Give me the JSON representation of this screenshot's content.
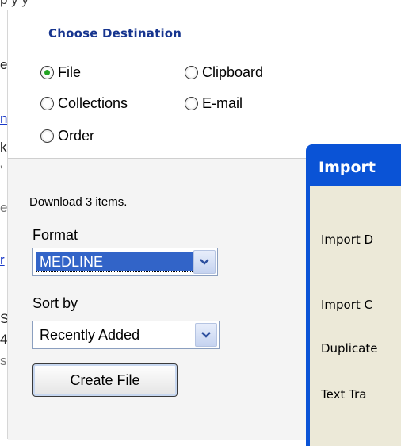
{
  "background": {
    "top_cut": "p        y        y",
    "fragments": [
      {
        "text": "e",
        "kind": "plain"
      },
      {
        "text": "n",
        "kind": "link"
      },
      {
        "text": "k",
        "kind": "plain"
      },
      {
        "text": "'",
        "kind": "gray"
      },
      {
        "text": "e",
        "kind": "gray"
      },
      {
        "text": "r",
        "kind": "link"
      },
      {
        "text": "S",
        "kind": "plain"
      },
      {
        "text": "4",
        "kind": "plain"
      },
      {
        "text": "s",
        "kind": "gray"
      }
    ]
  },
  "panel": {
    "title": "Choose Destination",
    "destinations": [
      {
        "label": "File",
        "checked": true
      },
      {
        "label": "Clipboard",
        "checked": false
      },
      {
        "label": "Collections",
        "checked": false
      },
      {
        "label": "E-mail",
        "checked": false
      },
      {
        "label": "Order",
        "checked": false
      }
    ],
    "download_text": "Download 3 items.",
    "format_label": "Format",
    "format_value": "MEDLINE",
    "sort_label": "Sort by",
    "sort_value": "Recently Added",
    "create_button": "Create File"
  },
  "import_dialog": {
    "title": "Import",
    "labels": [
      "Import D",
      "Import C",
      "Duplicate",
      "Text Tra"
    ]
  },
  "colors": {
    "title_blue": "#17358f",
    "dialog_blue": "#0a53d6",
    "radio_green": "#23a323",
    "select_highlight": "#3264c8"
  }
}
